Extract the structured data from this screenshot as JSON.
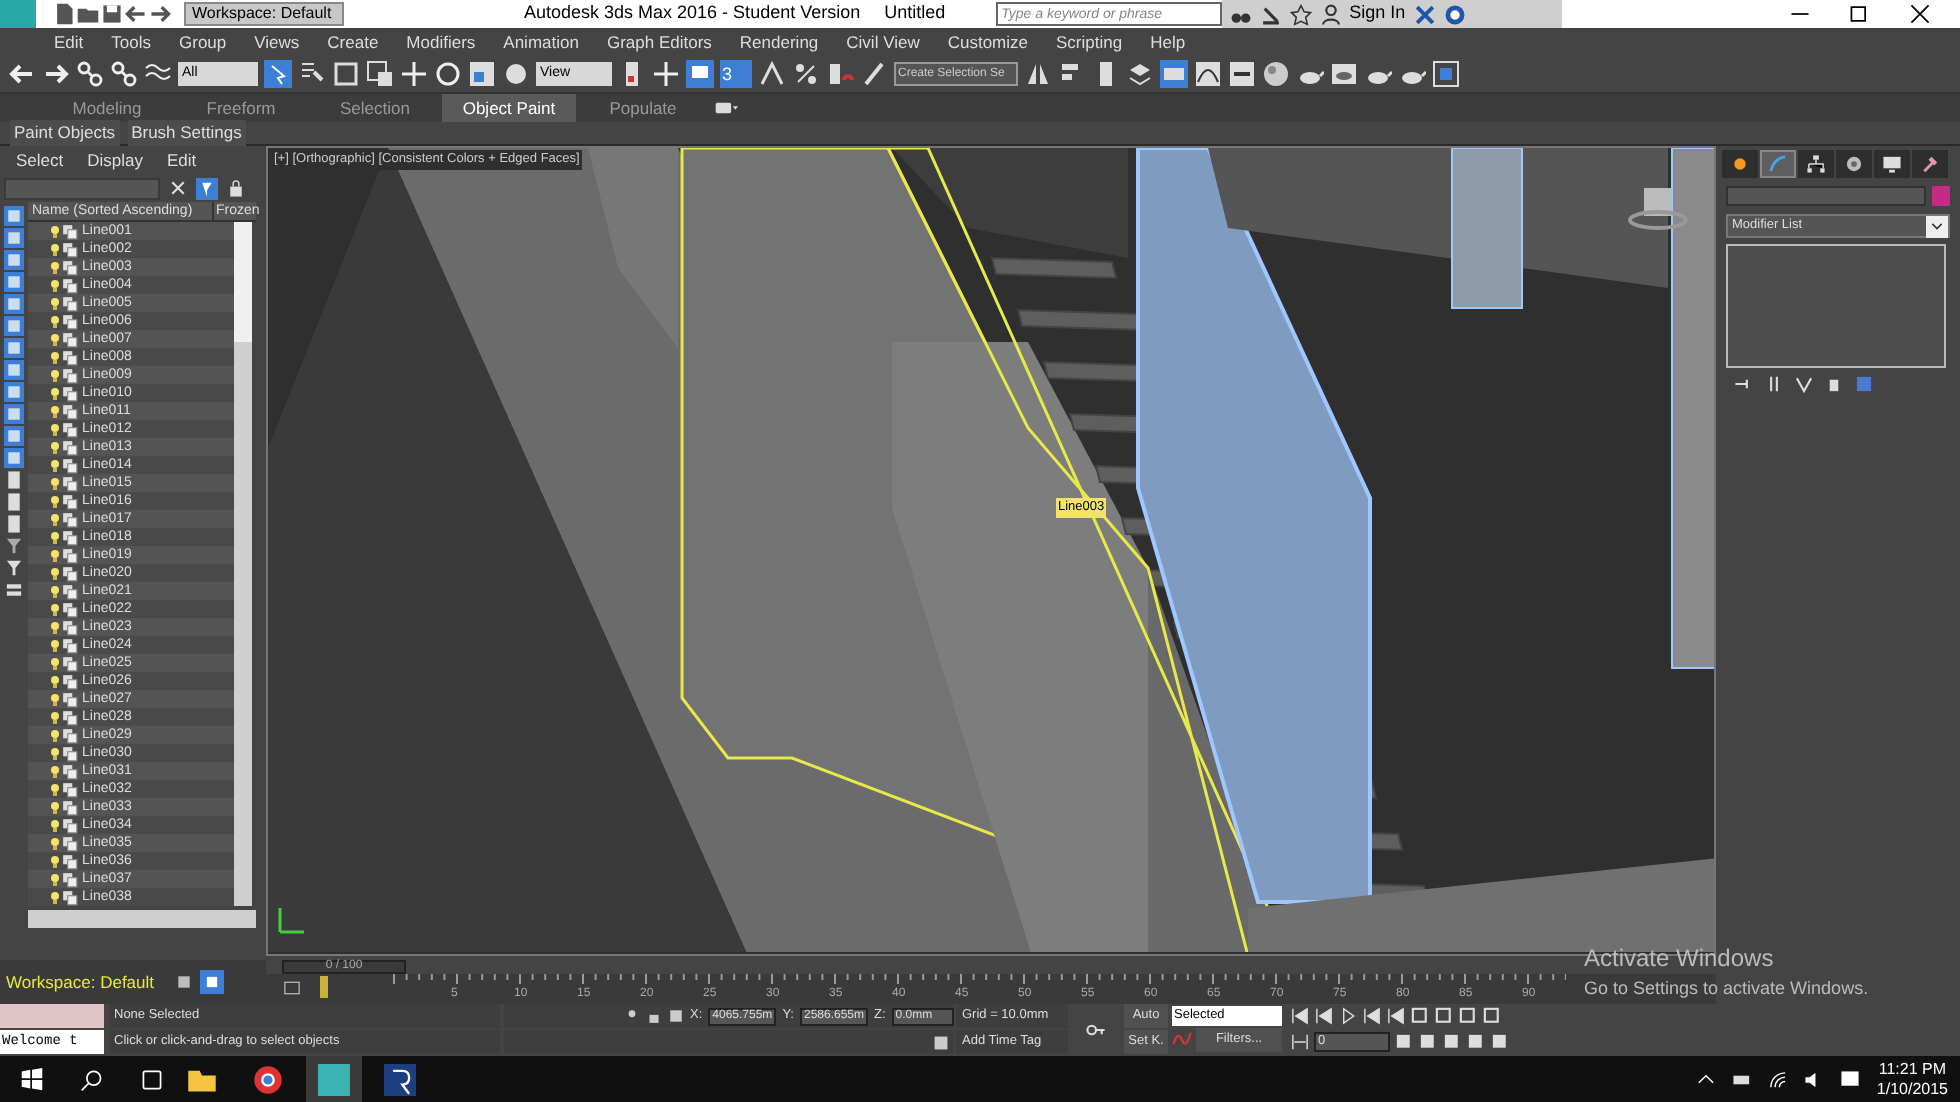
{
  "title_bar": {
    "workspace": "Workspace: Default",
    "title": "Autodesk 3ds Max 2016 - Student Version",
    "file": "Untitled",
    "search_placeholder": "Type a keyword or phrase",
    "sign_in": "Sign In"
  },
  "menu": [
    "Edit",
    "Tools",
    "Group",
    "Views",
    "Create",
    "Modifiers",
    "Animation",
    "Graph Editors",
    "Rendering",
    "Civil View",
    "Customize",
    "Scripting",
    "Help"
  ],
  "toolbar": {
    "selection_filter": "All",
    "reference_coord": "View",
    "snap_toggle": "3",
    "named_selection": "Create Selection Se"
  },
  "ribbon": {
    "tabs": [
      {
        "label": "Modeling",
        "selected": false
      },
      {
        "label": "Freeform",
        "selected": false
      },
      {
        "label": "Selection",
        "selected": false
      },
      {
        "label": "Object Paint",
        "selected": true
      },
      {
        "label": "Populate",
        "selected": false
      }
    ],
    "panels": [
      "Paint Objects",
      "Brush Settings"
    ]
  },
  "scene_explorer": {
    "menu": [
      "Select",
      "Display",
      "Edit"
    ],
    "columns": [
      "Name (Sorted Ascending)",
      "Frozen"
    ],
    "rows": [
      "Line001",
      "Line002",
      "Line003",
      "Line004",
      "Line005",
      "Line006",
      "Line007",
      "Line008",
      "Line009",
      "Line010",
      "Line011",
      "Line012",
      "Line013",
      "Line014",
      "Line015",
      "Line016",
      "Line017",
      "Line018",
      "Line019",
      "Line020",
      "Line021",
      "Line022",
      "Line023",
      "Line024",
      "Line025",
      "Line026",
      "Line027",
      "Line028",
      "Line029",
      "Line030",
      "Line031",
      "Line032",
      "Line033",
      "Line034",
      "Line035",
      "Line036",
      "Line037",
      "Line038"
    ],
    "workspace": "Workspace: Default"
  },
  "viewport": {
    "label": "[+] [Orthographic] [Consistent Colors + Edged Faces]",
    "object_label": "Line003"
  },
  "command_panel": {
    "tabs": [
      {
        "selected": false
      },
      {
        "selected": true
      },
      {
        "selected": false
      },
      {
        "selected": false
      },
      {
        "selected": false
      },
      {
        "selected": false
      }
    ],
    "modifier_list": "Modifier List"
  },
  "timeline": {
    "counter": "0 / 100",
    "ticks": [
      "5",
      "10",
      "15",
      "20",
      "25",
      "30",
      "35",
      "40",
      "45",
      "50",
      "55",
      "60",
      "65",
      "70",
      "75",
      "80",
      "85",
      "90"
    ]
  },
  "status_bar": {
    "listener": "Welcome t",
    "selection": "None Selected",
    "prompt": "Click or click-and-drag to select objects",
    "x_label": "X:",
    "x": "4065.755m",
    "y_label": "Y:",
    "y": "2586.655m",
    "z_label": "Z:",
    "z": "0.0mm",
    "grid": "Grid = 10.0mm",
    "add_time_tag": "Add Time Tag",
    "auto_key": "Auto",
    "set_key": "Set K.",
    "key_filter": "Selected",
    "filters": "Filters...",
    "frame": "0"
  },
  "activation_notice": {
    "title": "Activate Windows",
    "text": "Go to Settings to activate Windows."
  },
  "taskbar": {
    "time": "11:21 PM",
    "date": "1/10/2015"
  }
}
